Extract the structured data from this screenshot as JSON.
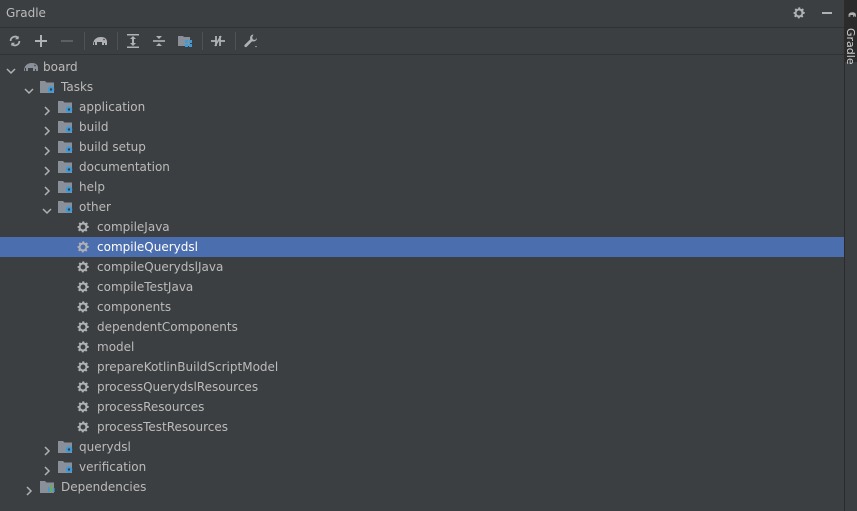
{
  "panel": {
    "title": "Gradle"
  },
  "side_tab": {
    "label": "Gradle"
  },
  "tree": [
    {
      "label": "board",
      "depth": 0,
      "arrow": "down",
      "icon": "elephant-icon",
      "selected": false
    },
    {
      "label": "Tasks",
      "depth": 1,
      "arrow": "down",
      "icon": "folder-gear-icon",
      "selected": false
    },
    {
      "label": "application",
      "depth": 2,
      "arrow": "right",
      "icon": "folder-gear-icon",
      "selected": false
    },
    {
      "label": "build",
      "depth": 2,
      "arrow": "right",
      "icon": "folder-gear-icon",
      "selected": false
    },
    {
      "label": "build setup",
      "depth": 2,
      "arrow": "right",
      "icon": "folder-gear-icon",
      "selected": false
    },
    {
      "label": "documentation",
      "depth": 2,
      "arrow": "right",
      "icon": "folder-gear-icon",
      "selected": false
    },
    {
      "label": "help",
      "depth": 2,
      "arrow": "right",
      "icon": "folder-gear-icon",
      "selected": false
    },
    {
      "label": "other",
      "depth": 2,
      "arrow": "down",
      "icon": "folder-gear-icon",
      "selected": false
    },
    {
      "label": "compileJava",
      "depth": 3,
      "arrow": "none",
      "icon": "gear-icon",
      "selected": false
    },
    {
      "label": "compileQuerydsl",
      "depth": 3,
      "arrow": "none",
      "icon": "gear-icon",
      "selected": true
    },
    {
      "label": "compileQuerydslJava",
      "depth": 3,
      "arrow": "none",
      "icon": "gear-icon",
      "selected": false
    },
    {
      "label": "compileTestJava",
      "depth": 3,
      "arrow": "none",
      "icon": "gear-icon",
      "selected": false
    },
    {
      "label": "components",
      "depth": 3,
      "arrow": "none",
      "icon": "gear-icon",
      "selected": false
    },
    {
      "label": "dependentComponents",
      "depth": 3,
      "arrow": "none",
      "icon": "gear-icon",
      "selected": false
    },
    {
      "label": "model",
      "depth": 3,
      "arrow": "none",
      "icon": "gear-icon",
      "selected": false
    },
    {
      "label": "prepareKotlinBuildScriptModel",
      "depth": 3,
      "arrow": "none",
      "icon": "gear-icon",
      "selected": false
    },
    {
      "label": "processQuerydslResources",
      "depth": 3,
      "arrow": "none",
      "icon": "gear-icon",
      "selected": false
    },
    {
      "label": "processResources",
      "depth": 3,
      "arrow": "none",
      "icon": "gear-icon",
      "selected": false
    },
    {
      "label": "processTestResources",
      "depth": 3,
      "arrow": "none",
      "icon": "gear-icon",
      "selected": false
    },
    {
      "label": "querydsl",
      "depth": 2,
      "arrow": "right",
      "icon": "folder-gear-icon",
      "selected": false
    },
    {
      "label": "verification",
      "depth": 2,
      "arrow": "right",
      "icon": "folder-gear-icon",
      "selected": false
    },
    {
      "label": "Dependencies",
      "depth": 1,
      "arrow": "right",
      "icon": "dependencies-icon",
      "selected": false
    }
  ],
  "colors": {
    "background": "#3c3f41",
    "selection": "#4b6eaf",
    "text": "#bbbbbb",
    "folder": "#8a9099",
    "gear_blue": "#3d9bd9"
  }
}
